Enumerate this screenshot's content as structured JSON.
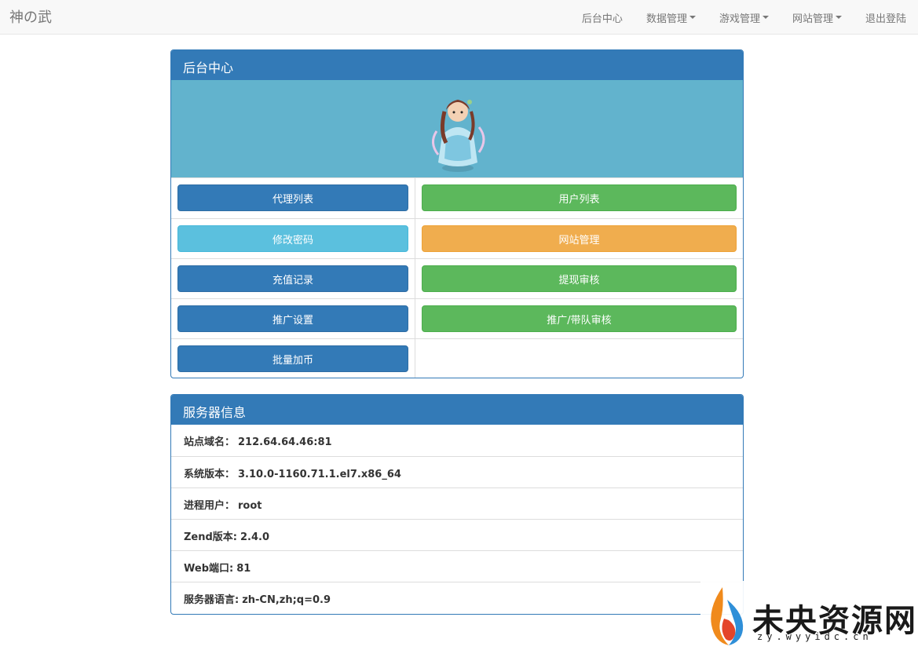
{
  "navbar": {
    "brand": "神の武",
    "items": [
      {
        "label": "后台中心",
        "dropdown": false
      },
      {
        "label": "数据管理",
        "dropdown": true
      },
      {
        "label": "游戏管理",
        "dropdown": true
      },
      {
        "label": "网站管理",
        "dropdown": true
      },
      {
        "label": "退出登陆",
        "dropdown": false
      }
    ]
  },
  "admin_panel": {
    "title": "后台中心",
    "buttons": {
      "agent_list": "代理列表",
      "user_list": "用户列表",
      "change_password": "修改密码",
      "site_manage": "网站管理",
      "recharge_records": "充值记录",
      "withdraw_review": "提现审核",
      "promo_settings": "推广设置",
      "promo_team_review": "推广/带队审核",
      "batch_add_coins": "批量加币"
    }
  },
  "server_panel": {
    "title": "服务器信息",
    "rows": [
      {
        "label": "站点域名：",
        "value": "212.64.64.46:81"
      },
      {
        "label": "系统版本：",
        "value": "3.10.0-1160.71.1.el7.x86_64"
      },
      {
        "label": "进程用户：",
        "value": "root"
      },
      {
        "label": "Zend版本:",
        "value": "2.4.0"
      },
      {
        "label": "Web端口:",
        "value": "81"
      },
      {
        "label": "服务器语言:",
        "value": "zh-CN,zh;q=0.9"
      }
    ]
  },
  "watermark": {
    "text": "未央资源网",
    "sub": "zy.wyyidc.cn"
  },
  "colors": {
    "primary": "#337ab7",
    "success": "#5cb85c",
    "info": "#5bc0de",
    "warning": "#f0ad4e",
    "banner": "#62b3cd"
  }
}
